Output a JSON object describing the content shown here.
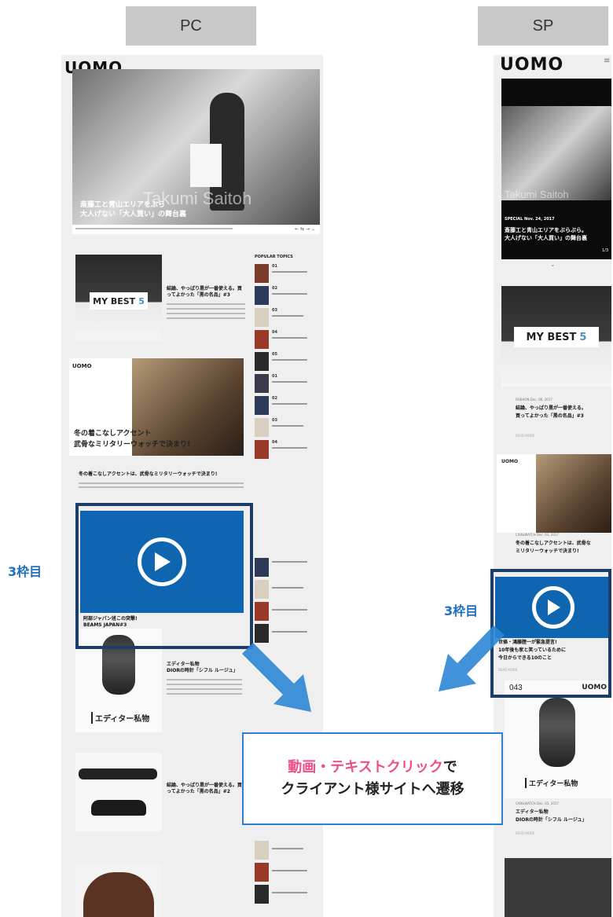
{
  "labels": {
    "pc": "PC",
    "sp": "SP",
    "pc_frame": "3枠目",
    "sp_frame": "3枠目"
  },
  "callout": {
    "line1_pink": "動画・テキストクリック",
    "line1_rest": "で",
    "line2": "クライアント様サイトへ遷移"
  },
  "pc": {
    "logo": "UOMO",
    "hero": {
      "name_overlay": "Takumi Saitoh",
      "title_line1": "斎藤工と青山エリアをぶら",
      "title_line2": "大人げない「大人買い」の舞台裏"
    },
    "popular_topics": "POPULAR TOPICS",
    "pop_numbers": [
      "01",
      "02",
      "03",
      "04",
      "05",
      "01",
      "02",
      "03",
      "04",
      "05"
    ],
    "article1": {
      "thumb": "MY BEST 5",
      "thumb_word": "MY BEST",
      "thumb_num": "5",
      "title": "結論、やっぱり黒が一番使える。買ってよかった「黒の名品」#3"
    },
    "article2": {
      "badge": "UOMO",
      "banner_line1": "冬の着こなしアクセント",
      "banner_line2": "武骨なミリタリーウォッチで決まり!",
      "title": "冬の着こなしアクセントは、武骨なミリタリーウォッチで決まり!"
    },
    "article3": {
      "title_line1": "阿部ジャパン班この突撃!",
      "title_line2": "BEAMS JAPAN#3"
    },
    "article4": {
      "badge": "エディター私物",
      "title_line1": "エディター私物",
      "title_line2": "DIORの時計「シフル ルージュ」"
    },
    "article5": {
      "title": "結論、やっぱり黒が一番使える。買ってよかった「黒の名品」#2"
    }
  },
  "sp": {
    "logo": "UOMO",
    "hero": {
      "name_overlay": "Takumi Saitoh",
      "date": "SPECIAL  Nov. 24, 2017",
      "title_line1": "斎藤工と青山エリアをぶらぶら。",
      "title_line2": "大人げない「大人買い」の舞台裏",
      "counter": "1/3"
    },
    "article1": {
      "thumb_word": "MY BEST",
      "thumb_num": "5",
      "category": "FASHION  Dec. 06, 2017",
      "title_line1": "結論、やっぱり黒が一番使える。",
      "title_line2": "買ってよかった「黒の名品」#3",
      "more": "READ MORE"
    },
    "article2": {
      "badge": "UOMO",
      "category": "CAR&WATCH  Dec. 03, 2017",
      "title_line1": "冬の着こなしアクセントは、武骨な",
      "title_line2": "ミリタリーウォッチで決まり!"
    },
    "article3": {
      "title_line1": "世條・鴻藤腟一が緊急提言!",
      "title_line2": "10年後も家と笑っているために",
      "title_line3": "今日からできる10のこと",
      "more": "READ MORE"
    },
    "article4": {
      "number": "043",
      "brand": "UOMO",
      "badge": "エディター私物",
      "category": "CAR&WATCH  Dec. 05, 2017",
      "title_line1": "エディター私物",
      "title_line2": "DIORの時計「シフル ルージュ」",
      "more": "READ MORE"
    }
  },
  "colors": {
    "accent_blue": "#0f65b0",
    "frame_navy": "#1c3d67",
    "arrow_blue": "#2e86d6",
    "pink": "#f04e8a"
  }
}
